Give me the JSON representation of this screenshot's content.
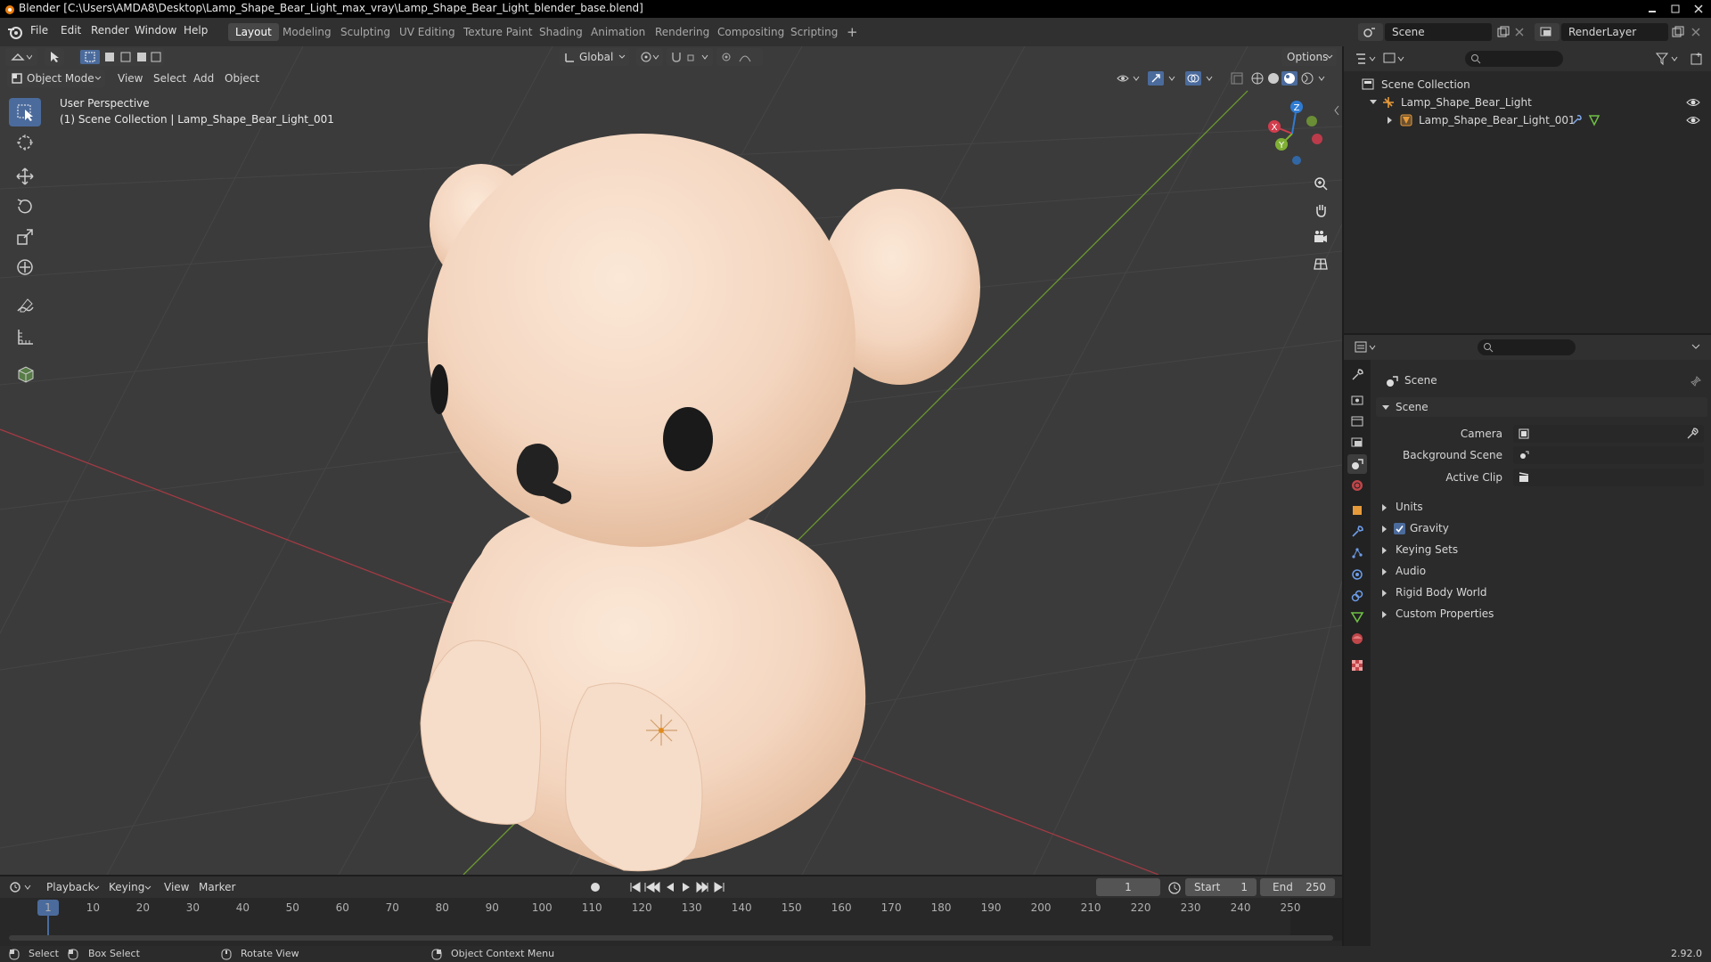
{
  "window": {
    "title": "Blender [C:\\Users\\AMDA8\\Desktop\\Lamp_Shape_Bear_Light_max_vray\\Lamp_Shape_Bear_Light_blender_base.blend]"
  },
  "menubar": {
    "items": [
      "File",
      "Edit",
      "Render",
      "Window",
      "Help"
    ]
  },
  "workspaces": {
    "tabs": [
      "Layout",
      "Modeling",
      "Sculpting",
      "UV Editing",
      "Texture Paint",
      "Shading",
      "Animation",
      "Rendering",
      "Compositing",
      "Scripting"
    ],
    "active": "Layout",
    "add": "+"
  },
  "scene_selector": {
    "scene": "Scene",
    "view_layer": "RenderLayer"
  },
  "viewport_toolbar": {
    "transform_orientation": "Global",
    "options_label": "Options"
  },
  "viewport_header": {
    "mode": "Object Mode",
    "menus": [
      "View",
      "Select",
      "Add",
      "Object"
    ]
  },
  "viewport": {
    "overlay_line1": "User Perspective",
    "overlay_line2": "(1) Scene Collection | Lamp_Shape_Bear_Light_001",
    "gizmo_axes": {
      "x": "X",
      "y": "Y",
      "z": "Z"
    }
  },
  "tools": [
    "select-box-icon",
    "cursor-icon",
    "move-icon",
    "rotate-icon",
    "scale-icon",
    "transform-icon",
    "annotate-icon",
    "measure-icon",
    "add-cube-icon"
  ],
  "outliner": {
    "root": "Scene Collection",
    "items": [
      {
        "label": "Lamp_Shape_Bear_Light",
        "type": "empty"
      },
      {
        "label": "Lamp_Shape_Bear_Light_001",
        "type": "mesh"
      }
    ]
  },
  "properties": {
    "context": "Scene",
    "panel_title": "Scene",
    "fields": [
      {
        "label": "Camera",
        "value": ""
      },
      {
        "label": "Background Scene",
        "value": ""
      },
      {
        "label": "Active Clip",
        "value": ""
      }
    ],
    "subpanels": [
      "Units",
      "Gravity",
      "Keying Sets",
      "Audio",
      "Rigid Body World",
      "Custom Properties"
    ],
    "gravity_checked": true
  },
  "timeline": {
    "menus": [
      "Playback",
      "Keying",
      "View",
      "Marker"
    ],
    "current_frame": "1",
    "start_label": "Start",
    "start": "1",
    "end_label": "End",
    "end": "250",
    "ticks": [
      "1",
      "10",
      "20",
      "30",
      "40",
      "50",
      "60",
      "70",
      "80",
      "90",
      "100",
      "110",
      "120",
      "130",
      "140",
      "150",
      "160",
      "170",
      "180",
      "190",
      "200",
      "210",
      "220",
      "230",
      "240",
      "250"
    ]
  },
  "statusbar": {
    "select": "Select",
    "box_select": "Box Select",
    "rotate_view": "Rotate View",
    "context_menu": "Object Context Menu",
    "version": "2.92.0"
  },
  "colors": {
    "accent": "#4b6b9c",
    "x_axis": "#d23c4d",
    "y_axis": "#7fb034",
    "z_axis": "#2f7bd3",
    "bear": "#f5d9c4"
  }
}
